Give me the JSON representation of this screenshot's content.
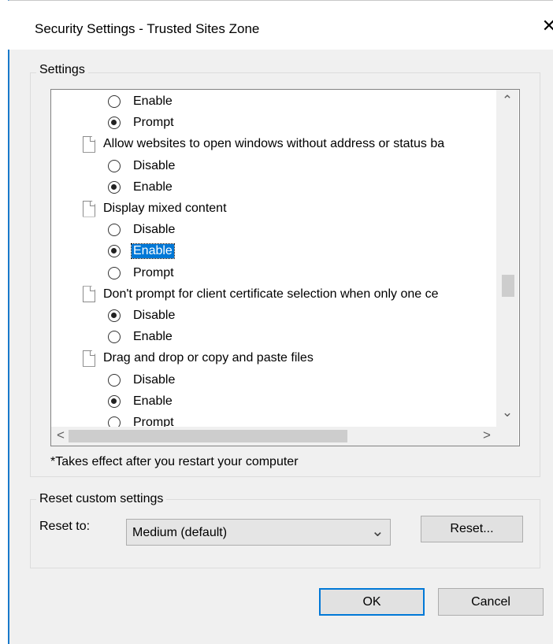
{
  "window": {
    "title": "Security Settings - Trusted Sites Zone",
    "close_glyph": "✕"
  },
  "settings_group": {
    "legend": "Settings"
  },
  "tree": [
    {
      "kind": "radio",
      "label": "Enable",
      "checked": false
    },
    {
      "kind": "radio",
      "label": "Prompt",
      "checked": true
    },
    {
      "kind": "item",
      "label": "Allow websites to open windows without address or status ba"
    },
    {
      "kind": "radio",
      "label": "Disable",
      "checked": false
    },
    {
      "kind": "radio",
      "label": "Enable",
      "checked": true
    },
    {
      "kind": "item",
      "label": "Display mixed content"
    },
    {
      "kind": "radio",
      "label": "Disable",
      "checked": false
    },
    {
      "kind": "radio",
      "label": "Enable",
      "checked": true,
      "selected": true
    },
    {
      "kind": "radio",
      "label": "Prompt",
      "checked": false
    },
    {
      "kind": "item",
      "label": "Don't prompt for client certificate selection when only one ce"
    },
    {
      "kind": "radio",
      "label": "Disable",
      "checked": true
    },
    {
      "kind": "radio",
      "label": "Enable",
      "checked": false
    },
    {
      "kind": "item",
      "label": "Drag and drop or copy and paste files"
    },
    {
      "kind": "radio",
      "label": "Disable",
      "checked": false
    },
    {
      "kind": "radio",
      "label": "Enable",
      "checked": true
    },
    {
      "kind": "radio",
      "label": "Prompt",
      "checked": false
    }
  ],
  "scroll": {
    "up": "⌃",
    "down": "⌄",
    "left": "<",
    "right": ">",
    "vertical_position": 0.6,
    "horizontal_position": 0.0
  },
  "note": "*Takes effect after you restart your computer",
  "reset_group": {
    "legend": "Reset custom settings",
    "label": "Reset to:",
    "selected": "Medium (default)",
    "dropdown_glyph": "⌄",
    "reset_button": "Reset..."
  },
  "buttons": {
    "ok": "OK",
    "cancel": "Cancel"
  },
  "colors": {
    "accent": "#0078d7",
    "window_bg": "#f0f0f0"
  }
}
